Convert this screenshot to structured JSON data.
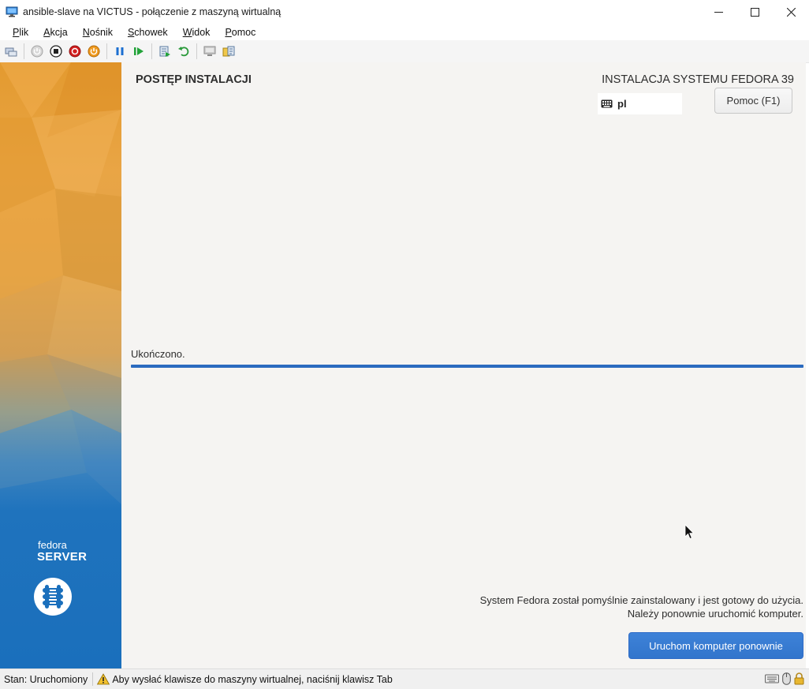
{
  "window": {
    "title": "ansible-slave na VICTUS - połączenie z maszyną wirtualną",
    "icon": "vm-connection-icon",
    "controls": [
      "minimize-icon",
      "maximize-icon",
      "close-icon"
    ]
  },
  "menu": {
    "items": [
      {
        "key": "P",
        "rest": "lik"
      },
      {
        "key": "A",
        "rest": "kcja"
      },
      {
        "key": "N",
        "rest": "ośnik"
      },
      {
        "key": "S",
        "rest": "chowek"
      },
      {
        "key": "W",
        "rest": "idok"
      },
      {
        "key": "P",
        "rest": "omoc"
      }
    ]
  },
  "toolbar": {
    "buttons": [
      "ctrl-alt-del-icon",
      "start-icon",
      "turn-off-icon",
      "shutdown-icon",
      "power-off-icon",
      "pause-icon",
      "resume-icon",
      "checkpoint-icon",
      "revert-icon",
      "enhanced-session-icon",
      "share-icon"
    ]
  },
  "installer": {
    "page_title": "POSTĘP INSTALACJI",
    "product_title": "INSTALACJA SYSTEMU FEDORA 39",
    "keyboard_layout": "pl",
    "help_button": "Pomoc (F1)",
    "status_label": "Ukończono.",
    "progress_fraction": 1.0,
    "final_message_line1": "System Fedora został pomyślnie zainstalowany i jest gotowy do użycia.",
    "final_message_line2": "Należy ponownie uruchomić komputer.",
    "reboot_button": "Uruchom komputer ponownie"
  },
  "branding": {
    "word1": "fedora",
    "word2": "SERVER",
    "logo": "fedora-server-logo-icon"
  },
  "statusbar": {
    "state": "Stan: Uruchomiony",
    "hint": "Aby wysłać klawisze do maszyny wirtualnej, naciśnij klawisz Tab",
    "icons": [
      "keyboard-icon",
      "mouse-icon",
      "lock-icon"
    ]
  },
  "colors": {
    "accent_blue": "#3275cc",
    "progress": "#2b6bbf",
    "sidebar_orange": "#e39a2f",
    "sidebar_blue": "#1a6fbc"
  }
}
